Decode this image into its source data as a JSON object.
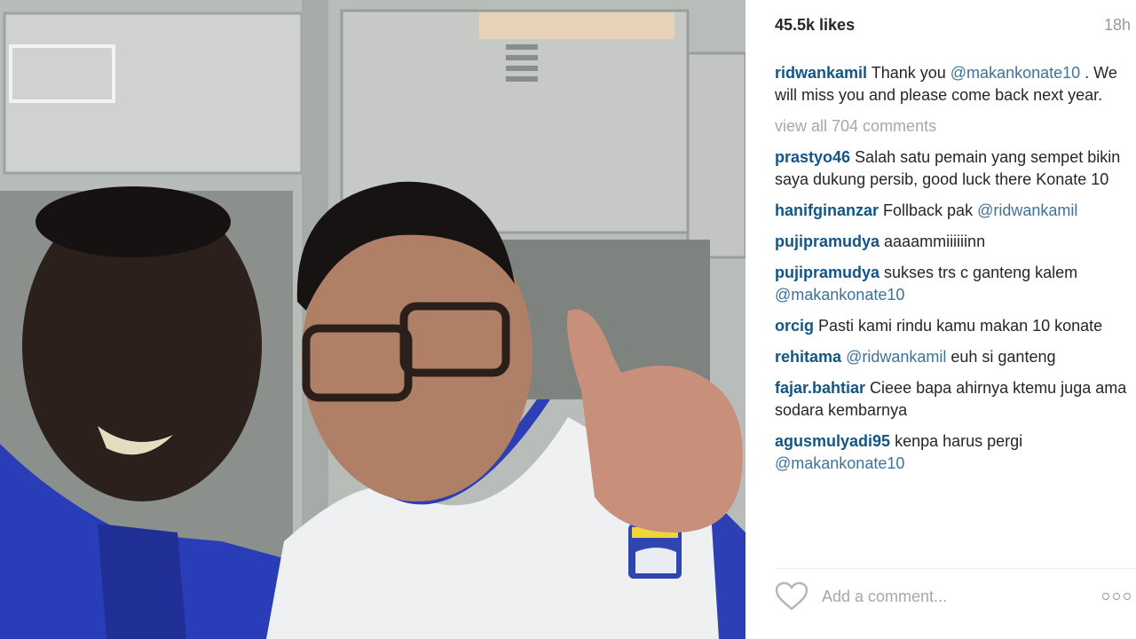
{
  "post": {
    "likes": "45.5k likes",
    "time": "18h"
  },
  "caption": {
    "user": "ridwankamil",
    "text_before": " Thank you ",
    "mention": "@makankonate10",
    "text_after": " . We will miss you and please come back next year."
  },
  "view_all": "view all 704 comments",
  "comments": [
    {
      "user": "prastyo46",
      "pre": " Salah satu pemain yang sempet bikin saya dukung persib, good luck there Konate 10",
      "mention": "",
      "post": ""
    },
    {
      "user": "hanifginanzar",
      "pre": " Follback pak ",
      "mention": "@ridwankamil",
      "post": ""
    },
    {
      "user": "pujipramudya",
      "pre": " aaaammiiiiiinn",
      "mention": "",
      "post": ""
    },
    {
      "user": "pujipramudya",
      "pre": " sukses trs c ganteng kalem ",
      "mention": "@makankonate10",
      "post": ""
    },
    {
      "user": "orcig",
      "pre": " Pasti kami rindu kamu makan 10 konate",
      "mention": "",
      "post": ""
    },
    {
      "user": "rehitama",
      "pre": " ",
      "mention": "@ridwankamil",
      "post": " euh si ganteng"
    },
    {
      "user": "fajar.bahtiar",
      "pre": " Cieee bapa ahirnya ktemu juga ama sodara kembarnya",
      "mention": "",
      "post": ""
    },
    {
      "user": "agusmulyadi95",
      "pre": " kenpa harus pergi ",
      "mention": "@makankonate10",
      "post": ""
    }
  ],
  "actions": {
    "add_comment_placeholder": "Add a comment...",
    "like_icon": "heart-icon",
    "more_icon": "more-options-icon"
  },
  "colors": {
    "username": "#125688",
    "mention": "#3f729b",
    "muted": "#a5a7aa"
  }
}
